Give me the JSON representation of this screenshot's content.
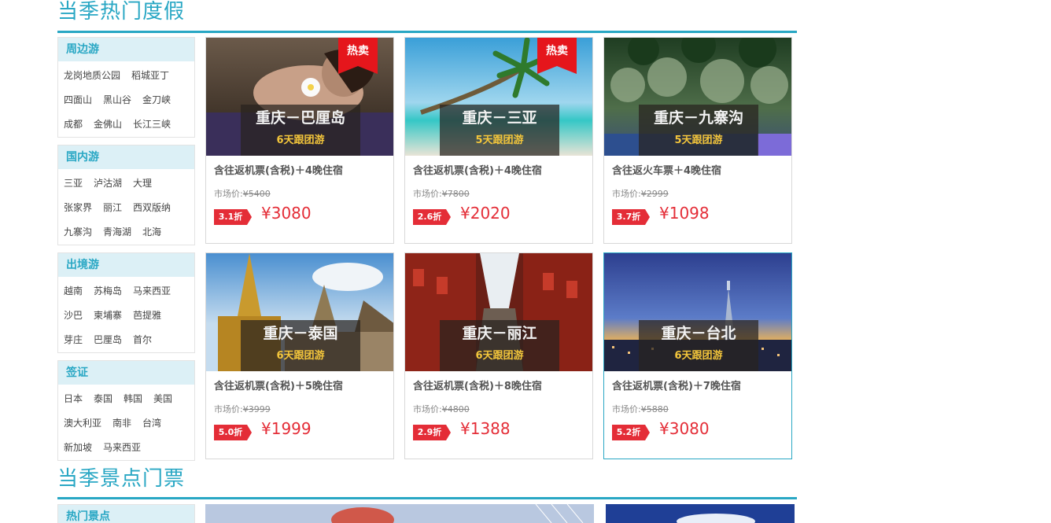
{
  "vacation": {
    "title": "当季热门度假",
    "categories": [
      {
        "name": "周边游",
        "rows": [
          [
            "龙岗地质公园",
            "稻城亚丁"
          ],
          [
            "四面山",
            "黑山谷",
            "金刀峡"
          ],
          [
            "成都",
            "金佛山",
            "长江三峡"
          ]
        ]
      },
      {
        "name": "国内游",
        "rows": [
          [
            "三亚",
            "泸沽湖",
            "大理"
          ],
          [
            "张家界",
            "丽江",
            "西双版纳"
          ],
          [
            "九寨沟",
            "青海湖",
            "北海"
          ]
        ]
      },
      {
        "name": "出境游",
        "rows": [
          [
            "越南",
            "苏梅岛",
            "马来西亚"
          ],
          [
            "沙巴",
            "柬埔寨",
            "芭提雅"
          ],
          [
            "芽庄",
            "巴厘岛",
            "首尔"
          ]
        ]
      },
      {
        "name": "签证",
        "rows": [
          [
            "日本",
            "泰国",
            "韩国",
            "美国"
          ],
          [
            "澳大利亚",
            "南非",
            "台湾"
          ],
          [
            "新加坡",
            "马来西亚"
          ]
        ]
      }
    ],
    "cards": [
      {
        "title": "重庆－巴厘岛",
        "sub": "6天跟团游",
        "hot": "热卖",
        "desc": "含往返机票(含税)＋4晚住宿",
        "market_label": "市场价:",
        "market": "¥5400",
        "discount": "3.1折",
        "price": "¥3080",
        "scene": "spa"
      },
      {
        "title": "重庆－三亚",
        "sub": "5天跟团游",
        "hot": "热卖",
        "desc": "含往返机票(含税)＋4晚住宿",
        "market_label": "市场价:",
        "market": "¥7800",
        "discount": "2.6折",
        "price": "¥2020",
        "scene": "beach"
      },
      {
        "title": "重庆－九寨沟",
        "sub": "5天跟团游",
        "hot": "",
        "desc": "含往返火车票＋4晚住宿",
        "market_label": "市场价:",
        "market": "¥2999",
        "discount": "3.7折",
        "price": "¥1098",
        "scene": "forest"
      },
      {
        "title": "重庆－泰国",
        "sub": "6天跟团游",
        "hot": "",
        "desc": "含往返机票(含税)＋5晚住宿",
        "market_label": "市场价:",
        "market": "¥3999",
        "discount": "5.0折",
        "price": "¥1999",
        "scene": "temple"
      },
      {
        "title": "重庆－丽江",
        "sub": "6天跟团游",
        "hot": "",
        "desc": "含往返机票(含税)＋8晚住宿",
        "market_label": "市场价:",
        "market": "¥4800",
        "discount": "2.9折",
        "price": "¥1388",
        "scene": "oldtown"
      },
      {
        "title": "重庆－台北",
        "sub": "6天跟团游",
        "hot": "",
        "desc": "含往返机票(含税)＋7晚住宿",
        "market_label": "市场价:",
        "market": "¥5880",
        "discount": "5.2折",
        "price": "¥3080",
        "scene": "city"
      }
    ]
  },
  "tickets": {
    "title": "当季景点门票",
    "first_category": "热门景点"
  },
  "colors": {
    "accent": "#29a7c4",
    "price": "#e42d37",
    "hot": "#e5161c",
    "caption_sub": "#f4c63b"
  }
}
